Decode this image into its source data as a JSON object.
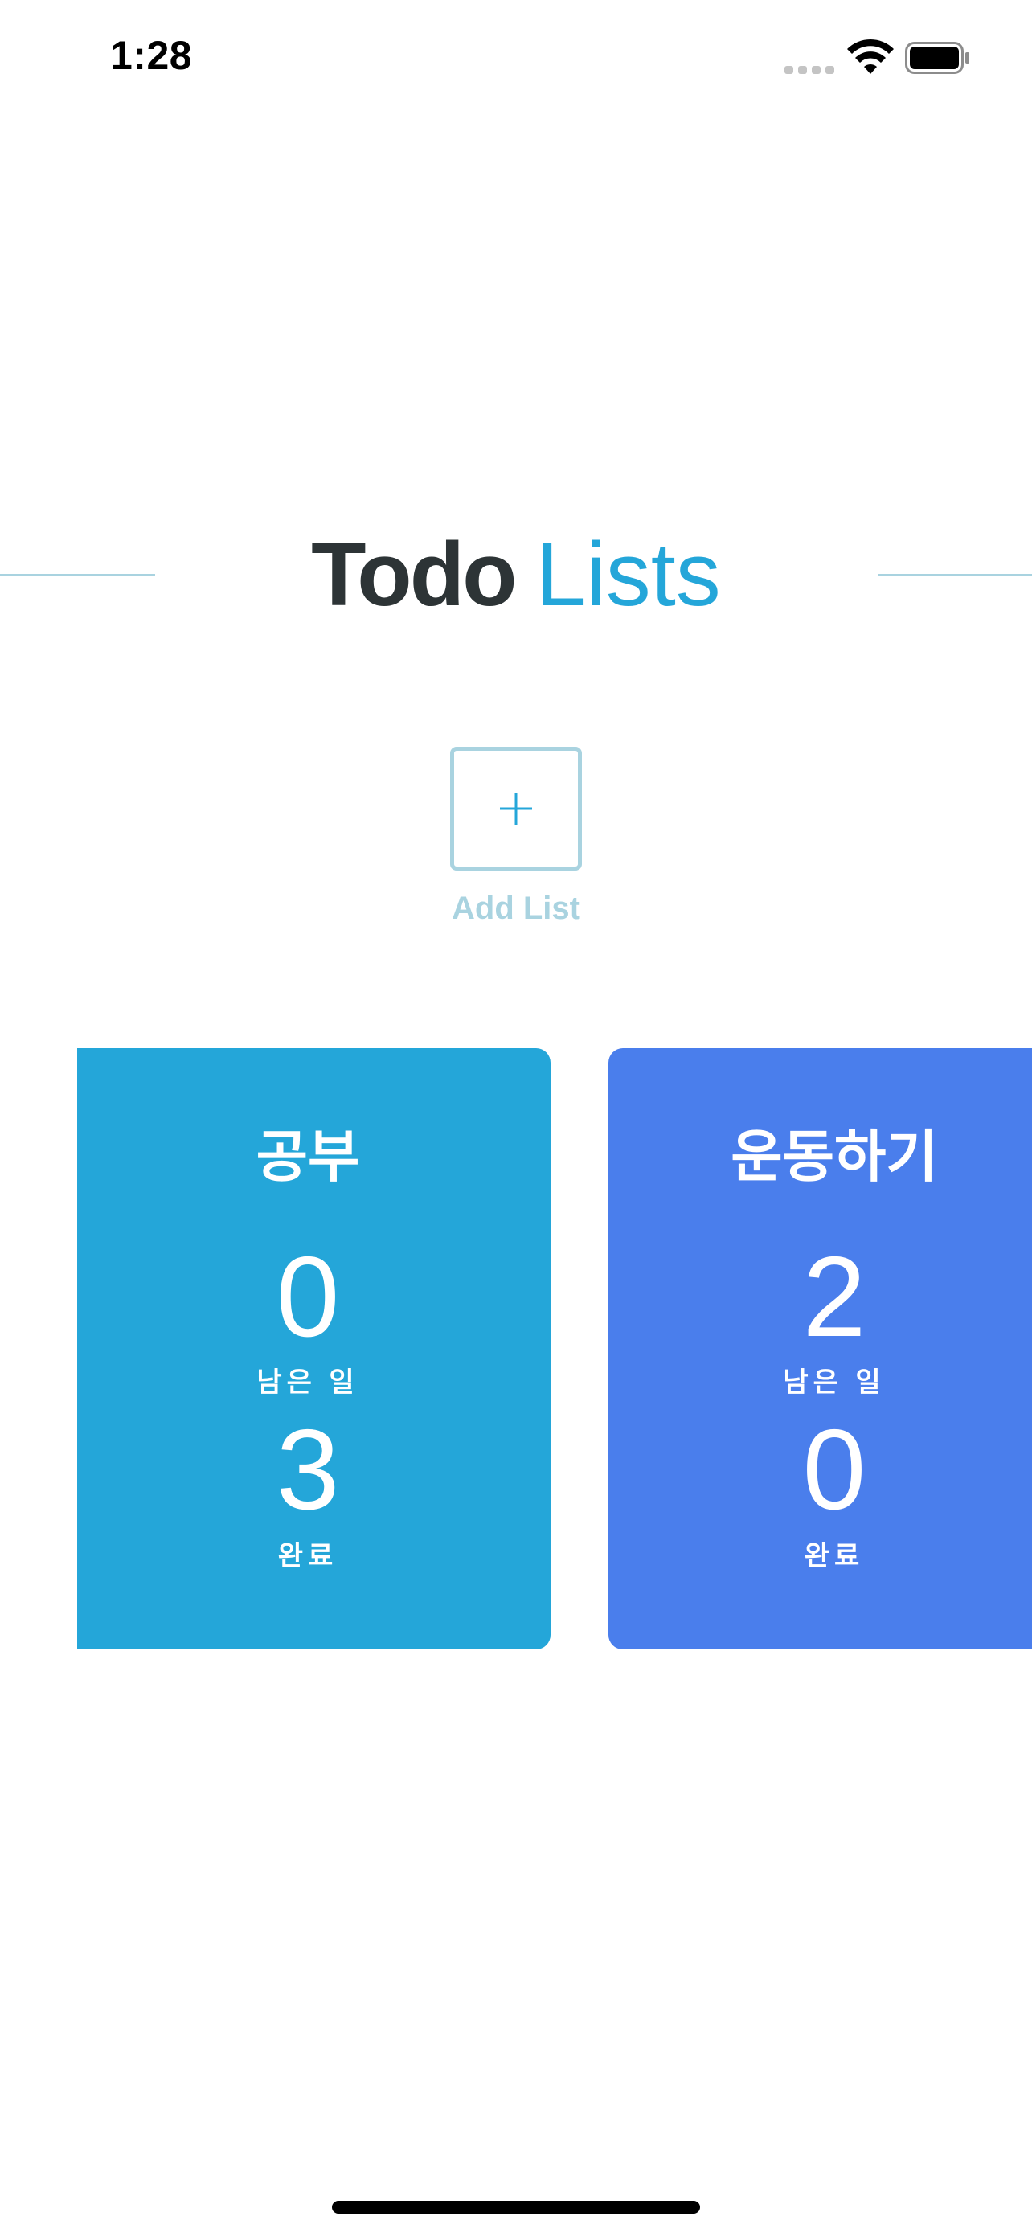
{
  "status_bar": {
    "time": "1:28"
  },
  "header": {
    "title_bold": "Todo",
    "title_light": "Lists"
  },
  "add_list": {
    "label": "Add List",
    "icon": "plus-icon"
  },
  "lists": [
    {
      "name": "공부",
      "remaining": "0",
      "remaining_label": "남은 일",
      "completed": "3",
      "completed_label": "완료",
      "color": "#24a6d9"
    },
    {
      "name": "운동하기",
      "remaining": "2",
      "remaining_label": "남은 일",
      "completed": "0",
      "completed_label": "완료",
      "color": "#4a7eec"
    }
  ],
  "colors": {
    "accent": "#24a6d9",
    "title_dark": "#2d3436",
    "muted_border": "#a9d3e0"
  }
}
